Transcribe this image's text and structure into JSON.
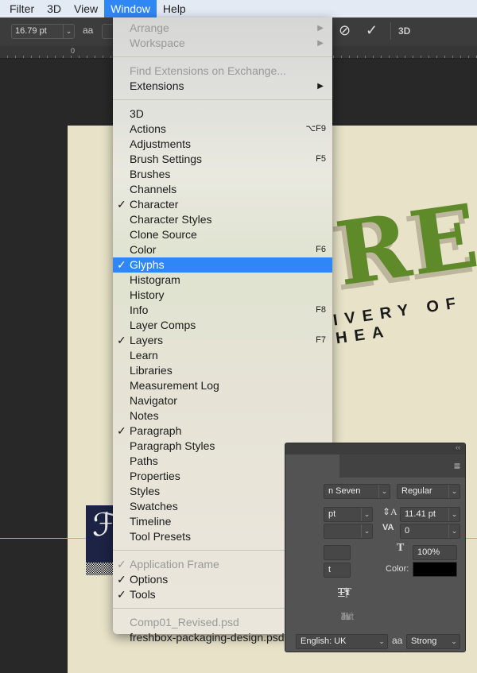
{
  "menubar": [
    "Filter",
    "3D",
    "View",
    "Window",
    "Help"
  ],
  "optbar": {
    "size": "16.79 pt",
    "aa_icon": "aa",
    "cancel_icon": "cancel-icon",
    "commit_icon": "check-icon",
    "label_3d": "3D"
  },
  "ruler": {
    "zero": "0"
  },
  "canvas": {
    "tagline": "IVERY OF HEA",
    "logo": "RES"
  },
  "menu": {
    "groups": [
      [
        {
          "label": "Arrange",
          "disabled": true,
          "submenu": true
        },
        {
          "label": "Workspace",
          "disabled": true,
          "submenu": true
        }
      ],
      [
        {
          "label": "Find Extensions on Exchange...",
          "disabled": true
        },
        {
          "label": "Extensions",
          "submenu": true
        }
      ],
      [
        {
          "label": "3D"
        },
        {
          "label": "Actions",
          "shortcut": "⌥F9"
        },
        {
          "label": "Adjustments"
        },
        {
          "label": "Brush Settings",
          "shortcut": "F5"
        },
        {
          "label": "Brushes"
        },
        {
          "label": "Channels"
        },
        {
          "label": "Character",
          "checked": true
        },
        {
          "label": "Character Styles"
        },
        {
          "label": "Clone Source"
        },
        {
          "label": "Color",
          "shortcut": "F6"
        },
        {
          "label": "Glyphs",
          "checked": true,
          "selected": true
        },
        {
          "label": "Histogram"
        },
        {
          "label": "History"
        },
        {
          "label": "Info",
          "shortcut": "F8"
        },
        {
          "label": "Layer Comps"
        },
        {
          "label": "Layers",
          "checked": true,
          "shortcut": "F7"
        },
        {
          "label": "Learn"
        },
        {
          "label": "Libraries"
        },
        {
          "label": "Measurement Log"
        },
        {
          "label": "Navigator"
        },
        {
          "label": "Notes"
        },
        {
          "label": "Paragraph",
          "checked": true
        },
        {
          "label": "Paragraph Styles"
        },
        {
          "label": "Paths"
        },
        {
          "label": "Properties"
        },
        {
          "label": "Styles"
        },
        {
          "label": "Swatches"
        },
        {
          "label": "Timeline"
        },
        {
          "label": "Tool Presets"
        }
      ],
      [
        {
          "label": "Application Frame",
          "checked": true,
          "disabled": true
        },
        {
          "label": "Options",
          "checked": true
        },
        {
          "label": "Tools",
          "checked": true
        }
      ],
      [
        {
          "label": "Comp01_Revised.psd",
          "disabled": true
        },
        {
          "label": "freshbox-packaging-design.psd"
        }
      ]
    ]
  },
  "panel": {
    "collapse": "‹‹",
    "font_family": "n Seven",
    "font_style": "Regular",
    "font_size": "pt",
    "leading": "11.41 pt",
    "tracking": "0",
    "vscale_partial": "",
    "hscale": "100%",
    "baseline_partial": "t",
    "color_label": "Color:",
    "color": "#000000",
    "style_buttons": [
      "TT",
      "Tт",
      "T¹",
      "T₁",
      "T",
      "T"
    ],
    "opentype_buttons": [
      "st",
      "𝒜",
      "aa",
      "T",
      "1st",
      "½"
    ],
    "language": "English: UK",
    "aa_icon": "aa",
    "antialias": "Strong"
  }
}
